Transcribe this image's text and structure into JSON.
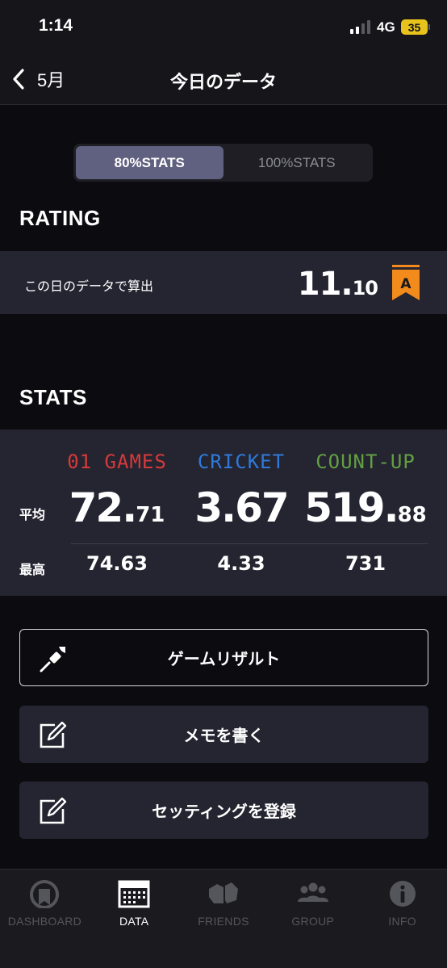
{
  "status_bar": {
    "time": "1:14",
    "network": "4G",
    "battery": "35"
  },
  "nav": {
    "back_label": "5月",
    "title": "今日のデータ"
  },
  "segmented": {
    "options": [
      "80%STATS",
      "100%STATS"
    ],
    "selected": "80%STATS"
  },
  "rating": {
    "heading": "RATING",
    "label": "この日のデータで算出",
    "value_int": "11.",
    "value_dec": "10",
    "flag_letter": "A",
    "flag_color": "#f28a1c"
  },
  "stats": {
    "heading": "STATS",
    "row_labels": {
      "avg": "平均",
      "max": "最高"
    },
    "columns": [
      {
        "name": "01 GAMES",
        "color": "#d53a3a",
        "avg_int": "72.",
        "avg_dec": "71",
        "max": "74.63"
      },
      {
        "name": "CRICKET",
        "color": "#2f7ad8",
        "avg_int": "3.67",
        "avg_dec": "",
        "max": "4.33"
      },
      {
        "name": "COUNT-UP",
        "color": "#62a043",
        "avg_int": "519.",
        "avg_dec": "88",
        "max": "731"
      }
    ]
  },
  "actions": {
    "game_result": "ゲームリザルト",
    "write_memo": "メモを書く",
    "register_setting": "セッティングを登録"
  },
  "tabs": [
    {
      "label": "DASHBOARD",
      "icon": "dashboard-icon",
      "active": false
    },
    {
      "label": "DATA",
      "icon": "calendar-icon",
      "active": true
    },
    {
      "label": "FRIENDS",
      "icon": "friends-icon",
      "active": false
    },
    {
      "label": "GROUP",
      "icon": "group-icon",
      "active": false
    },
    {
      "label": "INFO",
      "icon": "info-icon",
      "active": false
    }
  ]
}
